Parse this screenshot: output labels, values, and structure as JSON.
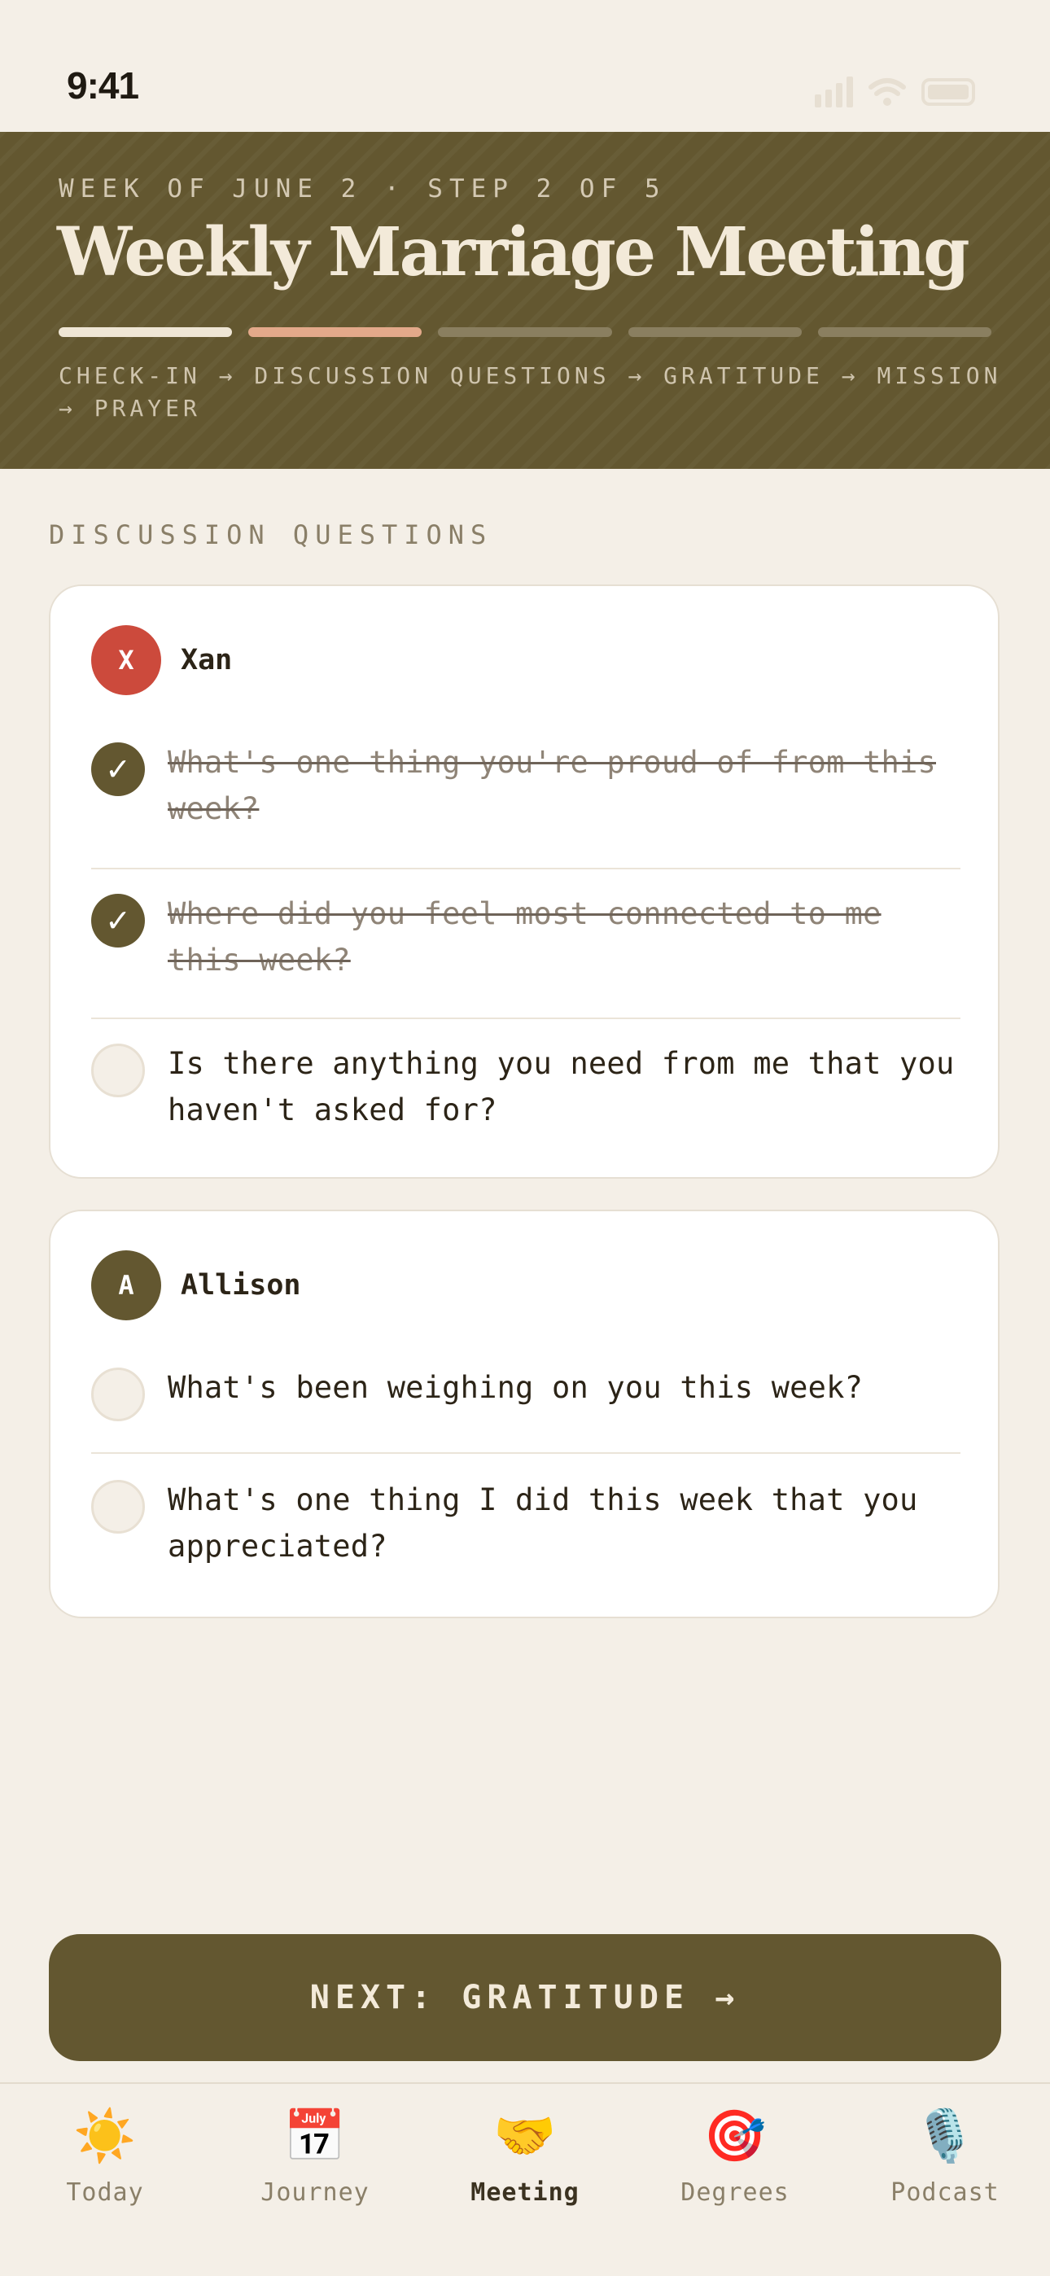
{
  "status": {
    "time": "9:41"
  },
  "header": {
    "kicker": "WEEK OF JUNE 2 · STEP 2 OF 5",
    "title": "Weekly Marriage Meeting",
    "progress": {
      "total_steps": 5,
      "current_step": 2
    },
    "steps_line": "CHECK-IN → DISCUSSION QUESTIONS → GRATITUDE → MISSION → PRAYER"
  },
  "section_label": "DISCUSSION QUESTIONS",
  "cards": [
    {
      "initial": "X",
      "name": "Xan",
      "avatar_color": "#cc4a3c",
      "questions": [
        {
          "text": "What's one thing you're proud of from this week?",
          "checked": true
        },
        {
          "text": "Where did you feel most connected to me this week?",
          "checked": true
        },
        {
          "text": "Is there anything you need from me that you haven't asked for?",
          "checked": false
        }
      ]
    },
    {
      "initial": "A",
      "name": "Allison",
      "avatar_color": "#635730",
      "questions": [
        {
          "text": "What's been weighing on you this week?",
          "checked": false
        },
        {
          "text": "What's one thing I did this week that you appreciated?",
          "checked": false
        }
      ]
    }
  ],
  "next_button": {
    "label": "NEXT: GRATITUDE →"
  },
  "tabs": [
    {
      "label": "Today",
      "icon": "sun-icon",
      "glyph": "☀️",
      "active": false
    },
    {
      "label": "Journey",
      "icon": "calendar-icon",
      "glyph": "📅",
      "active": false
    },
    {
      "label": "Meeting",
      "icon": "handshake-icon",
      "glyph": "🤝",
      "active": true
    },
    {
      "label": "Degrees",
      "icon": "target-icon",
      "glyph": "🎯",
      "active": false
    },
    {
      "label": "Podcast",
      "icon": "microphone-icon",
      "glyph": "🎙️",
      "active": false
    }
  ],
  "colors": {
    "accent": "#635730",
    "background": "#f4efe7",
    "progress_active": "#e3a98a",
    "xan_avatar": "#cc4a3c"
  }
}
